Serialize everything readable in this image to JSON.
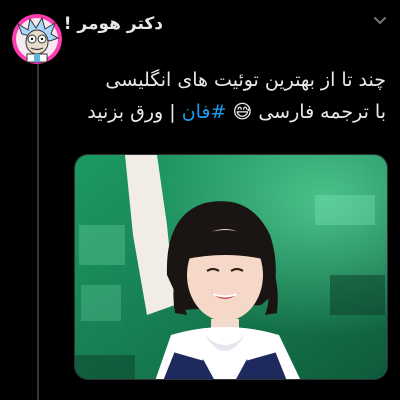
{
  "tweet": {
    "author_name": "دکتر هومر !",
    "text_line1": "چند تا از بهترین توئیت های انگلیسی",
    "text_line2_part1": "با ترجمه فارسی",
    "emoji": "😅",
    "hashtag": "#فان",
    "text_line2_part3": "| ورق بزنید"
  },
  "icons": {
    "avatar": "rick-cartoon-avatar",
    "more": "more-options-icon"
  },
  "colors": {
    "background": "#000000",
    "text": "#e7e9ea",
    "hashtag": "#1d9bf0",
    "thread_line": "#333639",
    "avatar_border": "#ff3bb0",
    "media_bg": "#1f8f5a"
  }
}
